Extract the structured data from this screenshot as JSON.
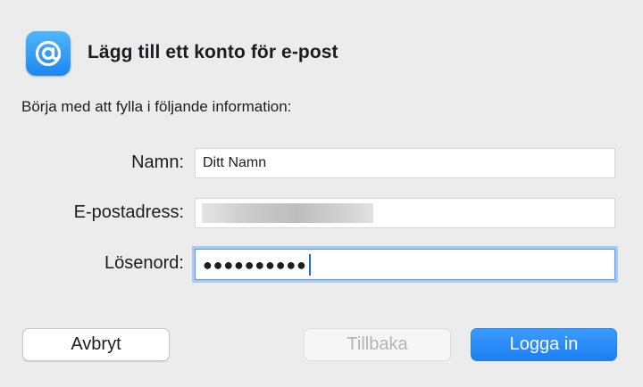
{
  "header": {
    "title": "Lägg till ett konto för e-post",
    "icon": "mail-at-icon"
  },
  "intro": "Börja med att fylla i följande information:",
  "form": {
    "name": {
      "label": "Namn:",
      "value": "Ditt Namn"
    },
    "email": {
      "label": "E-postadress:",
      "value_redacted": true
    },
    "password": {
      "label": "Lösenord:",
      "masked_value": "●●●●●●●●●●",
      "focused": true
    }
  },
  "buttons": {
    "cancel": "Avbryt",
    "back": "Tillbaka",
    "login": "Logga in"
  },
  "colors": {
    "accent": "#1e7ff2",
    "background": "#ececec",
    "focus_ring": "#a9c9f5"
  }
}
